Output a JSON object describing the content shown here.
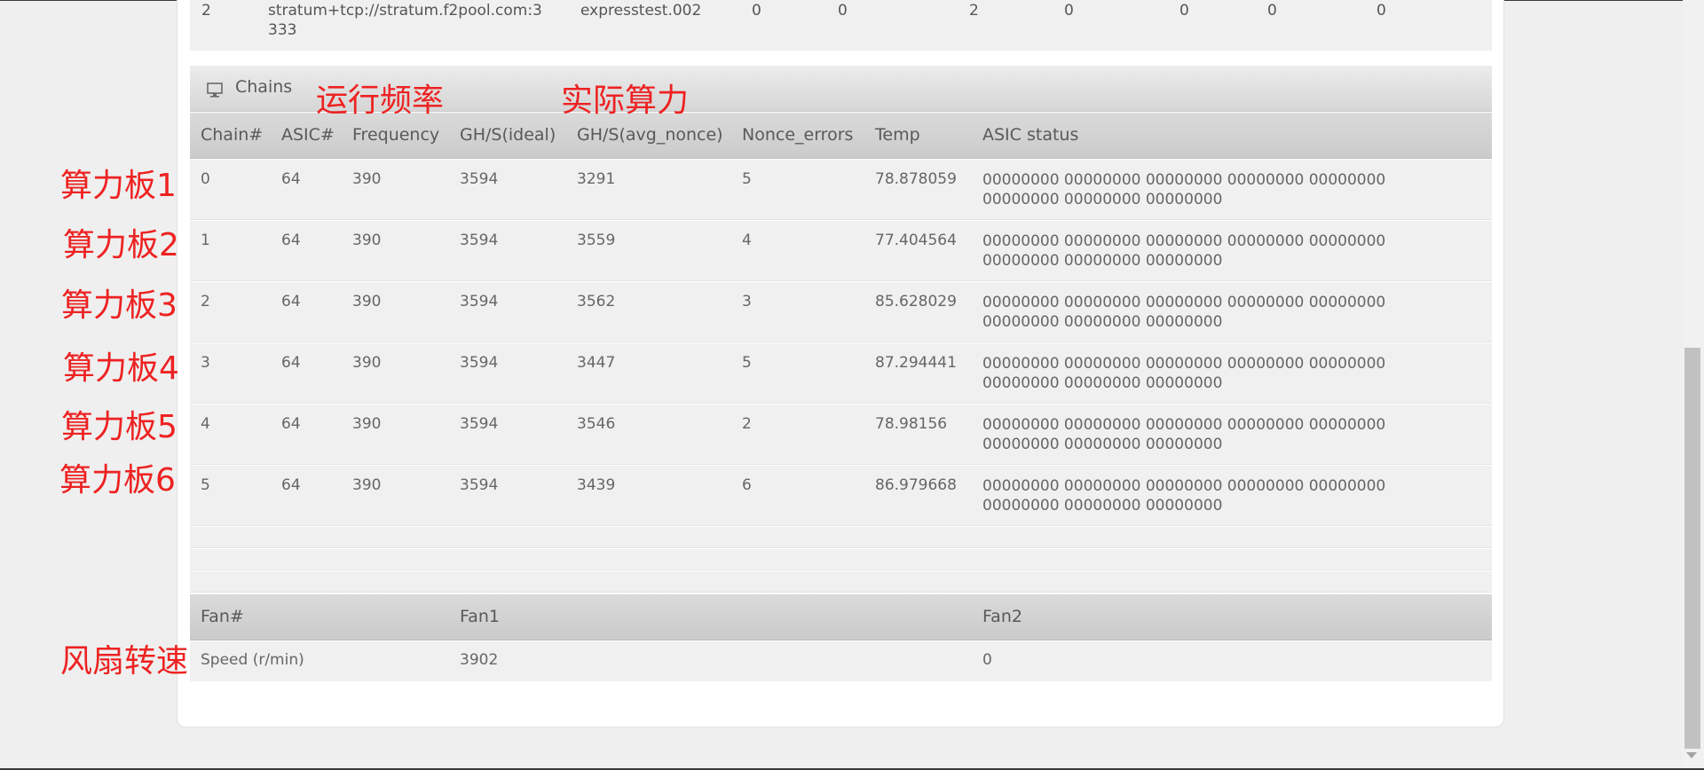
{
  "pool_row": {
    "index": "2",
    "url_line1": "stratum+tcp://stratum.f2pool.com:3",
    "url_line2": "333",
    "worker": "expresstest.002",
    "v1": "0",
    "v2": "0",
    "v3": "2",
    "v4": "0",
    "v5": "0",
    "v6": "0",
    "v7": "0"
  },
  "chains": {
    "title": "Chains",
    "icon": "monitor-icon",
    "headers": [
      "Chain#",
      "ASIC#",
      "Frequency",
      "GH/S(ideal)",
      "GH/S(avg_nonce)",
      "Nonce_errors",
      "Temp",
      "ASIC status"
    ],
    "rows": [
      {
        "chain": "0",
        "asic": "64",
        "freq": "390",
        "ideal": "3594",
        "avg": "3291",
        "errors": "5",
        "temp": "78.878059",
        "status": "00000000 00000000 00000000 00000000 00000000 00000000 00000000 00000000"
      },
      {
        "chain": "1",
        "asic": "64",
        "freq": "390",
        "ideal": "3594",
        "avg": "3559",
        "errors": "4",
        "temp": "77.404564",
        "status": "00000000 00000000 00000000 00000000 00000000 00000000 00000000 00000000"
      },
      {
        "chain": "2",
        "asic": "64",
        "freq": "390",
        "ideal": "3594",
        "avg": "3562",
        "errors": "3",
        "temp": "85.628029",
        "status": "00000000 00000000 00000000 00000000 00000000 00000000 00000000 00000000"
      },
      {
        "chain": "3",
        "asic": "64",
        "freq": "390",
        "ideal": "3594",
        "avg": "3447",
        "errors": "5",
        "temp": "87.294441",
        "status": "00000000 00000000 00000000 00000000 00000000 00000000 00000000 00000000"
      },
      {
        "chain": "4",
        "asic": "64",
        "freq": "390",
        "ideal": "3594",
        "avg": "3546",
        "errors": "2",
        "temp": "78.98156",
        "status": "00000000 00000000 00000000 00000000 00000000 00000000 00000000 00000000"
      },
      {
        "chain": "5",
        "asic": "64",
        "freq": "390",
        "ideal": "3594",
        "avg": "3439",
        "errors": "6",
        "temp": "86.979668",
        "status": "00000000 00000000 00000000 00000000 00000000 00000000 00000000 00000000"
      }
    ]
  },
  "fans": {
    "headers": [
      "Fan#",
      "Fan1",
      "Fan2"
    ],
    "row_label": "Speed (r/min)",
    "fan1": "3902",
    "fan2": "0"
  },
  "annotations": {
    "frequency": "运行频率",
    "actual_hashrate": "实际算力",
    "boards": [
      "算力板1",
      "算力板2",
      "算力板3",
      "算力板4",
      "算力板5",
      "算力板6"
    ],
    "fan_speed": "风扇转速"
  },
  "colors": {
    "annotation": "#ee2222",
    "header_bg": "#d0d0d0",
    "row_bg": "#f0f0f0"
  }
}
